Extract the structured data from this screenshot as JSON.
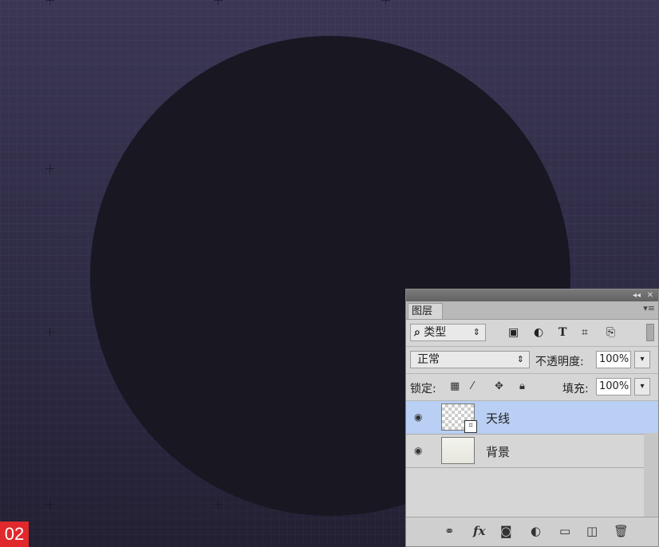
{
  "step_badge": "02",
  "panel": {
    "collapse_icon": "double-chevron-left-icon",
    "close_icon": "close-icon",
    "tab_label": "图层",
    "menu_icon": "panel-menu-icon",
    "filter": {
      "search_icon": "search-icon",
      "value": "类型",
      "arrow": "⇕",
      "icons": [
        "image-filter-icon",
        "adjustment-filter-icon",
        "type-filter-icon",
        "shape-filter-icon",
        "smart-object-filter-icon"
      ]
    },
    "blend_mode": "正常",
    "opacity_label": "不透明度:",
    "opacity_value": "100%",
    "lock_label": "锁定:",
    "fill_label": "填充:",
    "fill_value": "100%",
    "layers": [
      {
        "name": "天线",
        "selected": true,
        "visible": true
      },
      {
        "name": "背景",
        "selected": false,
        "visible": true
      }
    ],
    "bottom_icons": [
      "link-icon",
      "fx-icon",
      "mask-icon",
      "adjustment-layer-icon",
      "folder-icon",
      "new-layer-icon",
      "trash-icon"
    ]
  },
  "colors": {
    "canvas_top": "#3a3654",
    "canvas_bottom": "#232033",
    "circle": "#181722",
    "selection": "#b9cff4",
    "badge": "#e0282d"
  }
}
